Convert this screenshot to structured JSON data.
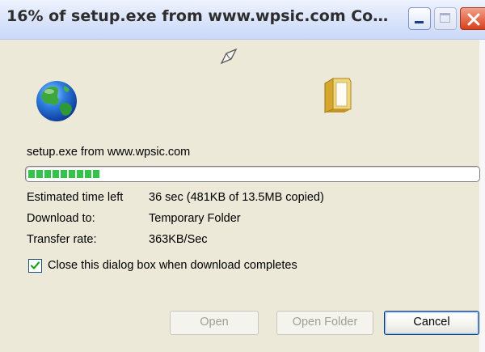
{
  "window": {
    "title": "16% of setup.exe from www.wpsic.com Com…"
  },
  "title_buttons": {
    "minimize_icon": "minimize-icon",
    "maximize_icon": "maximize-icon",
    "close_icon": "close-icon"
  },
  "animation": {
    "source_icon": "globe-icon",
    "flying_icon": "paper-icon",
    "target_icon": "folder-icon"
  },
  "source": {
    "text": "setup.exe from www.wpsic.com"
  },
  "progress": {
    "percent": 16,
    "color": "#33c24a"
  },
  "details": {
    "time_left_label": "Estimated time left",
    "time_left_value": "36 sec (481KB of 13.5MB copied)",
    "download_to_label": "Download to:",
    "download_to_value": "Temporary Folder",
    "transfer_rate_label": "Transfer rate:",
    "transfer_rate_value": "363KB/Sec"
  },
  "option": {
    "checked": true,
    "label": "Close this dialog box when download completes"
  },
  "buttons": {
    "open": "Open",
    "open_folder": "Open Folder",
    "cancel": "Cancel"
  }
}
